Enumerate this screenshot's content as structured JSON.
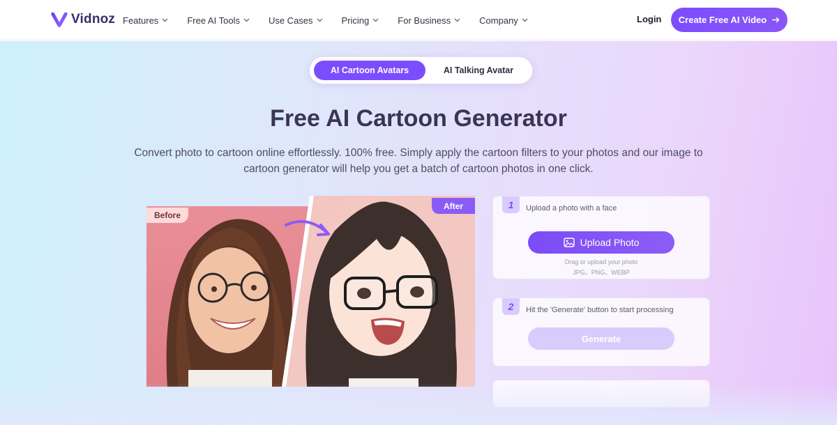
{
  "brand": {
    "name": "Vidnoz",
    "accent": "#7c4dff"
  },
  "nav": {
    "items": [
      {
        "label": "Features"
      },
      {
        "label": "Free AI Tools"
      },
      {
        "label": "Use Cases"
      },
      {
        "label": "Pricing"
      },
      {
        "label": "For Business"
      },
      {
        "label": "Company"
      }
    ],
    "login": "Login",
    "cta": "Create Free AI Video",
    "cta_icon": "arrow-right-icon"
  },
  "tabs": {
    "active": "AI Cartoon Avatars",
    "other": "AI Talking Avatar"
  },
  "hero": {
    "title": "Free AI Cartoon Generator",
    "subtitle": "Convert photo to cartoon online effortlessly. 100% free. Simply apply the cartoon filters to your photos and our image to cartoon generator will help you get a batch of cartoon photos in one click."
  },
  "compare": {
    "before_label": "Before",
    "after_label": "After"
  },
  "steps": {
    "step1": {
      "number": "1",
      "text": "Upload a photo with a face",
      "button": "Upload Photo",
      "button_icon": "image-icon",
      "hint": "Drag or upload your photo",
      "formats": "JPG、PNG、WEBP"
    },
    "step2": {
      "number": "2",
      "text": "Hit the 'Generate' button to start processing",
      "button": "Generate"
    }
  }
}
